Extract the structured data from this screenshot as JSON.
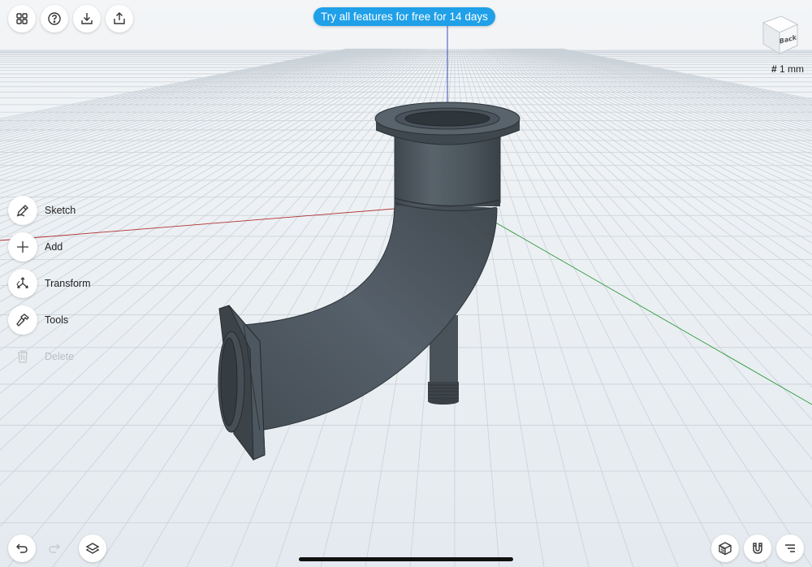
{
  "promo_banner": {
    "text": "Try all features for free for 14 days"
  },
  "top_toolbar": {
    "items": [
      {
        "name": "apps-grid-button",
        "icon": "grid-icon"
      },
      {
        "name": "help-button",
        "icon": "question-icon"
      },
      {
        "name": "import-button",
        "icon": "download-icon"
      },
      {
        "name": "export-button",
        "icon": "share-icon"
      }
    ]
  },
  "view_cube": {
    "face_label": "Back"
  },
  "grid": {
    "icon": "hash-icon",
    "size_label": "1 mm"
  },
  "tools": [
    {
      "label": "Sketch",
      "icon": "pencil-icon",
      "enabled": true
    },
    {
      "label": "Add",
      "icon": "plus-icon",
      "enabled": true
    },
    {
      "label": "Transform",
      "icon": "transform-icon",
      "enabled": true
    },
    {
      "label": "Tools",
      "icon": "hammer-icon",
      "enabled": true
    },
    {
      "label": "Delete",
      "icon": "trash-icon",
      "enabled": false
    }
  ],
  "bottom_left": [
    {
      "name": "undo-button",
      "icon": "undo-icon",
      "enabled": true
    },
    {
      "name": "redo-button",
      "icon": "redo-icon",
      "enabled": false
    },
    {
      "name": "layers-button",
      "icon": "layers-icon",
      "enabled": true
    }
  ],
  "bottom_right": [
    {
      "name": "render-mode-button",
      "icon": "shaded-cube-icon"
    },
    {
      "name": "snap-button",
      "icon": "magnet-icon"
    },
    {
      "name": "menu-button",
      "icon": "menu-lines-icon"
    }
  ],
  "colors": {
    "accent": "#1fa0e8",
    "background": "#e9eef2",
    "grid_line": "#c8d0d8",
    "model_fill": "#4e5860",
    "axis_x": "#b03030",
    "axis_y": "#2e9a3a",
    "axis_z": "#2a3ab8"
  }
}
